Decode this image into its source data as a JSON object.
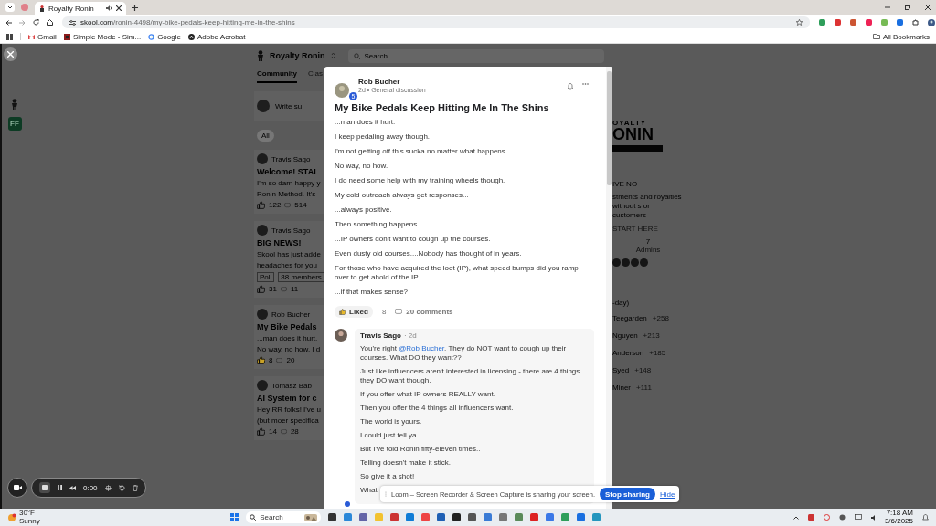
{
  "browser": {
    "tabs": [
      {
        "title": "Royalty Ronin",
        "selected": true
      }
    ],
    "url": {
      "host": "skool.com",
      "path": "/ronin-4498/my-bike-pedals-keep-hitting-me-in-the-shins"
    },
    "bookmarks": [
      "Gmail",
      "Simple Mode - Sim...",
      "Google",
      "Adobe Acrobat"
    ],
    "all_bookmarks": "All Bookmarks"
  },
  "background_page": {
    "community_name": "Royalty Ronin",
    "search_placeholder": "Search",
    "rail_badge": "FF",
    "tabs": [
      {
        "label": "Community",
        "selected": true
      },
      {
        "label": "Clas",
        "selected": false
      }
    ],
    "composer_placeholder": "Write su",
    "filter_chip": "All",
    "posts": [
      {
        "author": "Travis Sago",
        "title": "Welcome! STAI",
        "excerpt": [
          "I'm so darn happy y",
          "Ronin Method. It's"
        ],
        "likes": "122",
        "comments": "514",
        "liked": false
      },
      {
        "author": "Travis Sago",
        "title": "BIG NEWS!",
        "excerpt": [
          "Skool has just adde",
          "headaches for you"
        ],
        "tags": [
          "Poll",
          "88 members"
        ],
        "likes": "31",
        "comments": "11",
        "liked": false
      },
      {
        "author": "Rob Bucher",
        "title": "My Bike Pedals",
        "excerpt": [
          "...man does it hurt.",
          "No way, no how. I d"
        ],
        "likes": "8",
        "comments": "20",
        "liked": true
      },
      {
        "author": "Tomasz Bab",
        "title": "AI System for c",
        "excerpt": [
          "Hey RR folks! I've u",
          "(but moer specifica"
        ],
        "likes": "14",
        "comments": "28",
        "liked": false
      }
    ],
    "sidebar": {
      "logo_top": "OYALTY",
      "logo_main": "ONIN",
      "heading": "IVE NO",
      "description": [
        "stments and",
        "royalties without",
        "s or customers"
      ],
      "link": "START HERE",
      "stat_value": "7",
      "stat_label": "Admins",
      "leaderboard_title": "-day)",
      "leaders": [
        {
          "name": "Teegarden",
          "points": "+258"
        },
        {
          "name": "Nguyen",
          "points": "+213"
        },
        {
          "name": "Anderson",
          "points": "+185"
        },
        {
          "name": "Syed",
          "points": "+148"
        },
        {
          "name": "Miner",
          "points": "+111"
        }
      ]
    }
  },
  "post": {
    "author": "Rob Bucher",
    "level": "5",
    "meta": "2d • General discussion",
    "title": "My Bike Pedals Keep Hitting Me In The Shins",
    "paragraphs": [
      "...man does it hurt.",
      "I keep pedaling away though.",
      "I'm not getting off this sucka no matter what happens.",
      "No way, no how.",
      "I do need some help with my training wheels though.",
      "My cold outreach always get responses...",
      "...always positive.",
      "Then something happens...",
      "...IP owners don't want to cough up the courses.",
      "Even dusty old courses....Nobody has thought of in years.",
      "For those who have acquired the loot (IP), what speed bumps did you ramp over to get ahold of the IP.",
      "...if that makes sense?"
    ],
    "like": {
      "label": "Liked",
      "selected": true,
      "count": "8"
    },
    "comments": "20 comments"
  },
  "comment": {
    "author": "Travis Sago",
    "time": "· 2d",
    "paragraphs": [
      {
        "kind": "mention",
        "before": "You're right ",
        "mention": "@Rob Bucher",
        "after": ". They do NOT want to cough up their courses. What DO they want??"
      },
      {
        "kind": "plain",
        "text": "Just like influencers aren't interested in licensing - there are 4 things they DO want though."
      },
      {
        "kind": "plain",
        "text": "If you offer what IP owners REALLY want."
      },
      {
        "kind": "plain",
        "text": "Then you offer the 4 things all influencers want."
      },
      {
        "kind": "plain",
        "text": "The world is yours."
      },
      {
        "kind": "plain",
        "text": "I could just tell ya..."
      },
      {
        "kind": "plain",
        "text": "But I've told Ronin fifty-eleven times.."
      },
      {
        "kind": "plain",
        "text": "Telling doesn't make it stick."
      },
      {
        "kind": "plain",
        "text": "So give it a shot!"
      },
      {
        "kind": "plain",
        "text": "What"
      }
    ]
  },
  "recorder": {
    "time": "0:00"
  },
  "share_bar": {
    "message": "Loom – Screen Recorder & Screen Capture is sharing your screen.",
    "stop": "Stop sharing",
    "hide": "Hide"
  },
  "taskbar": {
    "temperature": "30°F",
    "weather": "Sunny",
    "search": "Search",
    "time": "7:18 AM",
    "date": "3/6/2025"
  }
}
